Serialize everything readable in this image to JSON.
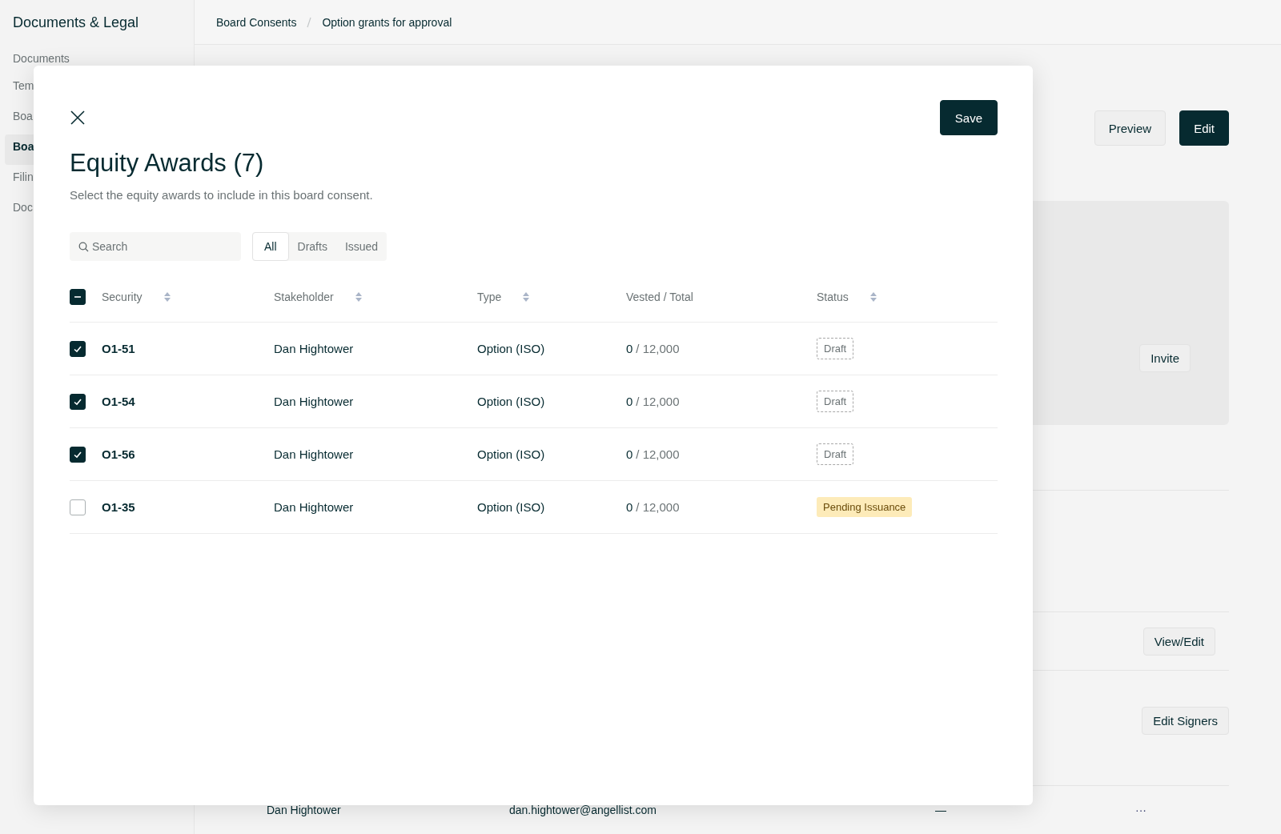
{
  "sidebar": {
    "title": "Documents & Legal",
    "items": [
      {
        "label": "Documents",
        "selected": false
      },
      {
        "label": "Tem",
        "selected": false
      },
      {
        "label": "Boa",
        "selected": false
      },
      {
        "label": "Boa",
        "selected": true
      },
      {
        "label": "Filin",
        "selected": false
      },
      {
        "label": "Doc",
        "selected": false
      }
    ]
  },
  "breadcrumbs": [
    "Board Consents",
    "Option grants for approval"
  ],
  "page_actions": [
    {
      "label": "Preview",
      "kind": "secondary"
    },
    {
      "label": "Edit",
      "kind": "primary"
    }
  ],
  "background_buttons": {
    "invite": "Invite",
    "view_edit": "View/Edit",
    "edit_signers": "Edit Signers"
  },
  "background_row": {
    "name": "Dan Hightower",
    "email": "dan.hightower@angellist.com",
    "column_3": "—",
    "menu": "···"
  },
  "modal": {
    "title": "Equity Awards (7)",
    "subtitle": "Select the equity awards to include in this board consent.",
    "save": "Save",
    "search": {
      "placeholder": "Search"
    },
    "filters": [
      {
        "label": "All",
        "selected": true
      },
      {
        "label": "Drafts",
        "selected": false
      },
      {
        "label": "Issued",
        "selected": false
      }
    ],
    "header_checkbox": {
      "indeterminate": true
    },
    "columns": [
      {
        "label": "Security",
        "sortable": true
      },
      {
        "label": "Stakeholder",
        "sortable": true
      },
      {
        "label": "Type",
        "sortable": true
      },
      {
        "label": "Vested / Total",
        "sortable": false
      },
      {
        "label": "Status",
        "sortable": true
      }
    ],
    "rows": [
      {
        "checked": true,
        "security": "O1-51",
        "stakeholder": "Dan Hightower",
        "type": "Option (ISO)",
        "vested": "0",
        "total": "/ 12,000",
        "status": {
          "label": "Draft",
          "kind": "draft"
        }
      },
      {
        "checked": true,
        "security": "O1-54",
        "stakeholder": "Dan Hightower",
        "type": "Option (ISO)",
        "vested": "0",
        "total": "/ 12,000",
        "status": {
          "label": "Draft",
          "kind": "draft"
        }
      },
      {
        "checked": true,
        "security": "O1-56",
        "stakeholder": "Dan Hightower",
        "type": "Option (ISO)",
        "vested": "0",
        "total": "/ 12,000",
        "status": {
          "label": "Draft",
          "kind": "draft"
        }
      },
      {
        "checked": false,
        "security": "O1-35",
        "stakeholder": "Dan Hightower",
        "type": "Option (ISO)",
        "vested": "0",
        "total": "/ 12,000",
        "status": {
          "label": "Pending Issuance",
          "kind": "pending"
        }
      }
    ]
  }
}
